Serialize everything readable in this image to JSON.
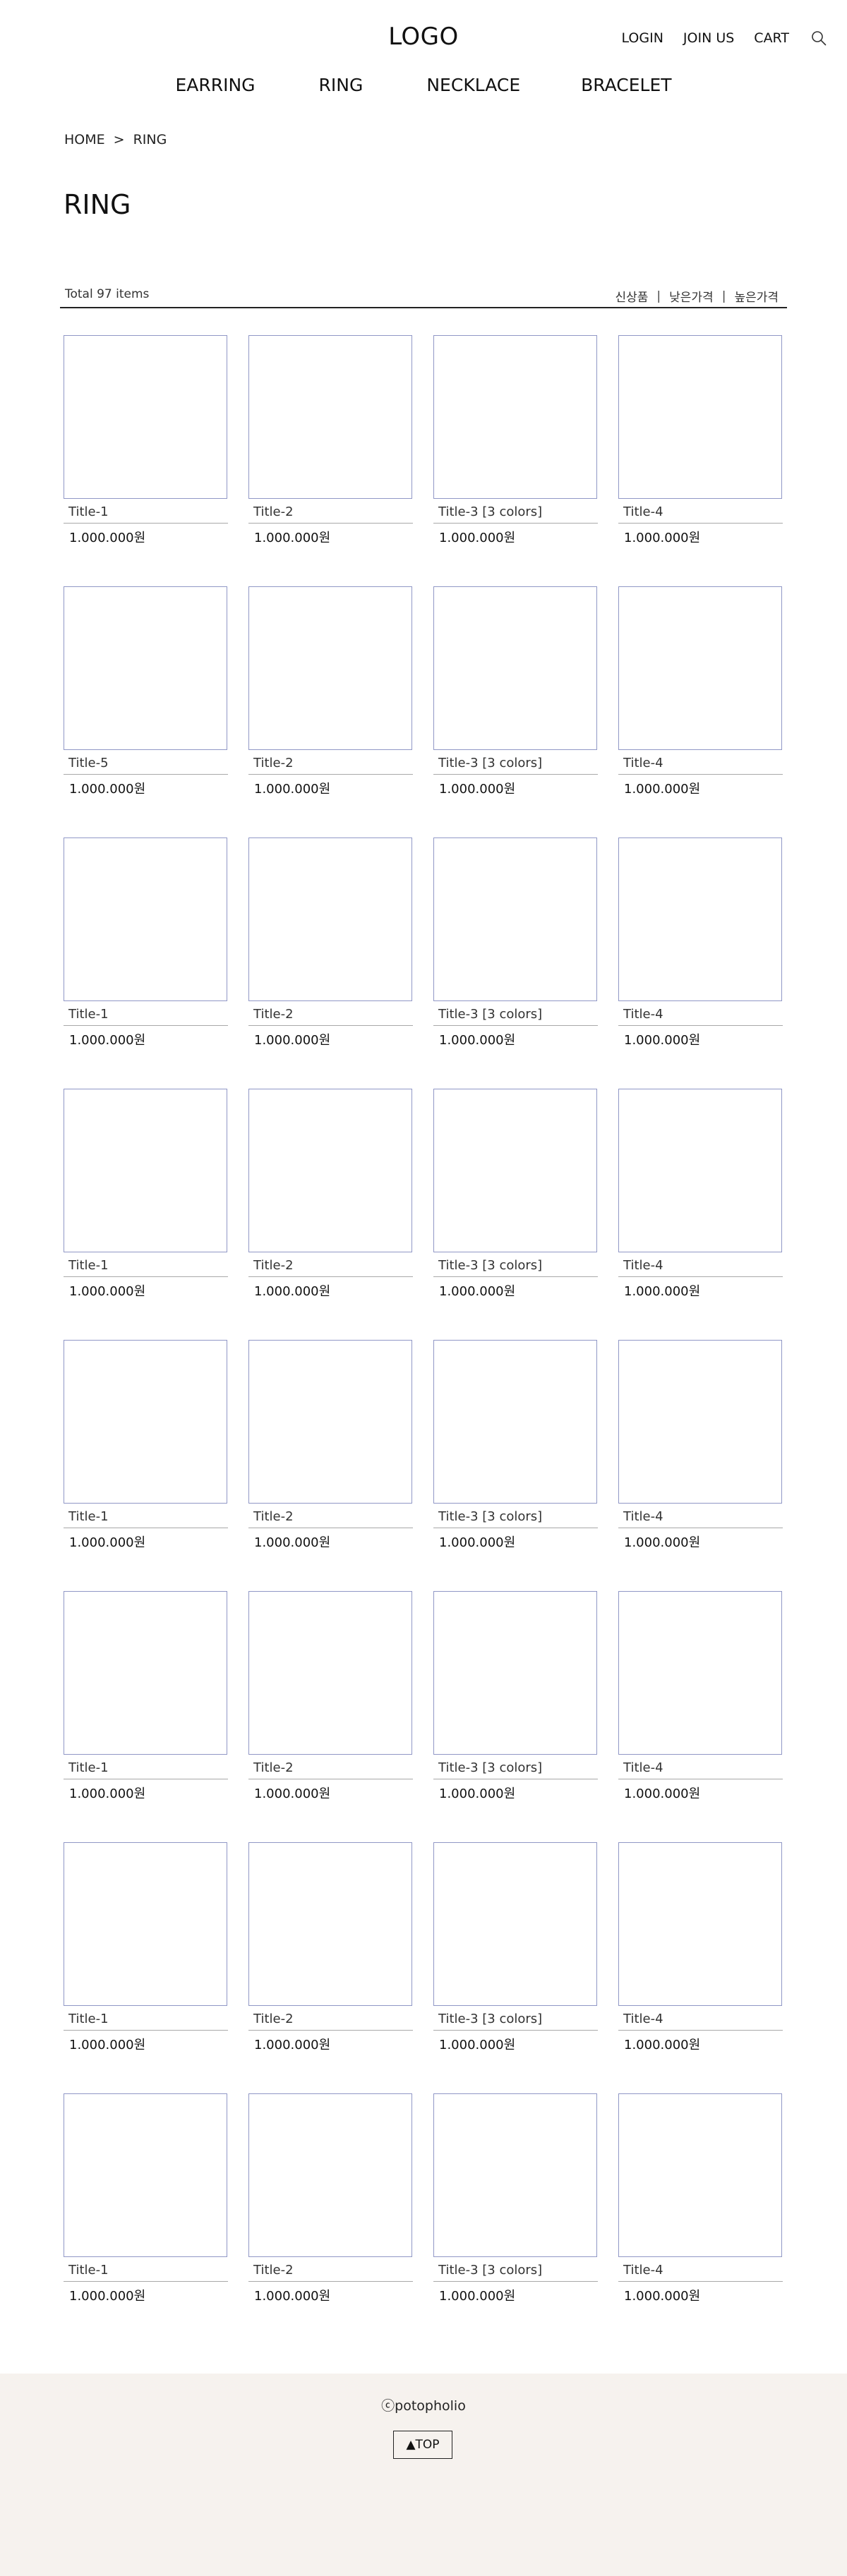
{
  "header": {
    "logo": "LOGO",
    "util_nav": [
      "LOGIN",
      "JOIN US",
      "CART"
    ],
    "search_icon": "search-icon",
    "main_nav": [
      "EARRING",
      "RING",
      "NECKLACE",
      "BRACELET"
    ]
  },
  "breadcrumb": {
    "home": "HOME",
    "separator": ">",
    "current": "RING"
  },
  "page_title": "RING",
  "toolbar": {
    "total": "Total 97 items",
    "sorts": [
      "신상품",
      "낮은가격",
      "높은가격"
    ],
    "sort_divider": "|"
  },
  "products": [
    [
      {
        "title": "Title-1",
        "price": "1.000.000원"
      },
      {
        "title": "Title-2",
        "price": "1.000.000원"
      },
      {
        "title": "Title-3 [3 colors]",
        "price": "1.000.000원"
      },
      {
        "title": "Title-4",
        "price": "1.000.000원"
      }
    ],
    [
      {
        "title": "Title-5",
        "price": "1.000.000원"
      },
      {
        "title": "Title-2",
        "price": "1.000.000원"
      },
      {
        "title": "Title-3 [3 colors]",
        "price": "1.000.000원"
      },
      {
        "title": "Title-4",
        "price": "1.000.000원"
      }
    ],
    [
      {
        "title": "Title-1",
        "price": "1.000.000원"
      },
      {
        "title": "Title-2",
        "price": "1.000.000원"
      },
      {
        "title": "Title-3 [3 colors]",
        "price": "1.000.000원"
      },
      {
        "title": "Title-4",
        "price": "1.000.000원"
      }
    ],
    [
      {
        "title": "Title-1",
        "price": "1.000.000원"
      },
      {
        "title": "Title-2",
        "price": "1.000.000원"
      },
      {
        "title": "Title-3 [3 colors]",
        "price": "1.000.000원"
      },
      {
        "title": "Title-4",
        "price": "1.000.000원"
      }
    ],
    [
      {
        "title": "Title-1",
        "price": "1.000.000원"
      },
      {
        "title": "Title-2",
        "price": "1.000.000원"
      },
      {
        "title": "Title-3 [3 colors]",
        "price": "1.000.000원"
      },
      {
        "title": "Title-4",
        "price": "1.000.000원"
      }
    ],
    [
      {
        "title": "Title-1",
        "price": "1.000.000원"
      },
      {
        "title": "Title-2",
        "price": "1.000.000원"
      },
      {
        "title": "Title-3 [3 colors]",
        "price": "1.000.000원"
      },
      {
        "title": "Title-4",
        "price": "1.000.000원"
      }
    ],
    [
      {
        "title": "Title-1",
        "price": "1.000.000원"
      },
      {
        "title": "Title-2",
        "price": "1.000.000원"
      },
      {
        "title": "Title-3 [3 colors]",
        "price": "1.000.000원"
      },
      {
        "title": "Title-4",
        "price": "1.000.000원"
      }
    ],
    [
      {
        "title": "Title-1",
        "price": "1.000.000원"
      },
      {
        "title": "Title-2",
        "price": "1.000.000원"
      },
      {
        "title": "Title-3 [3 colors]",
        "price": "1.000.000원"
      },
      {
        "title": "Title-4",
        "price": "1.000.000원"
      }
    ]
  ],
  "footer": {
    "copyright": "ⓒpotopholio",
    "top_button": "▲TOP"
  },
  "colors": {
    "thumb_border": "#9097c6",
    "footer_bg": "#f6f2ee"
  }
}
